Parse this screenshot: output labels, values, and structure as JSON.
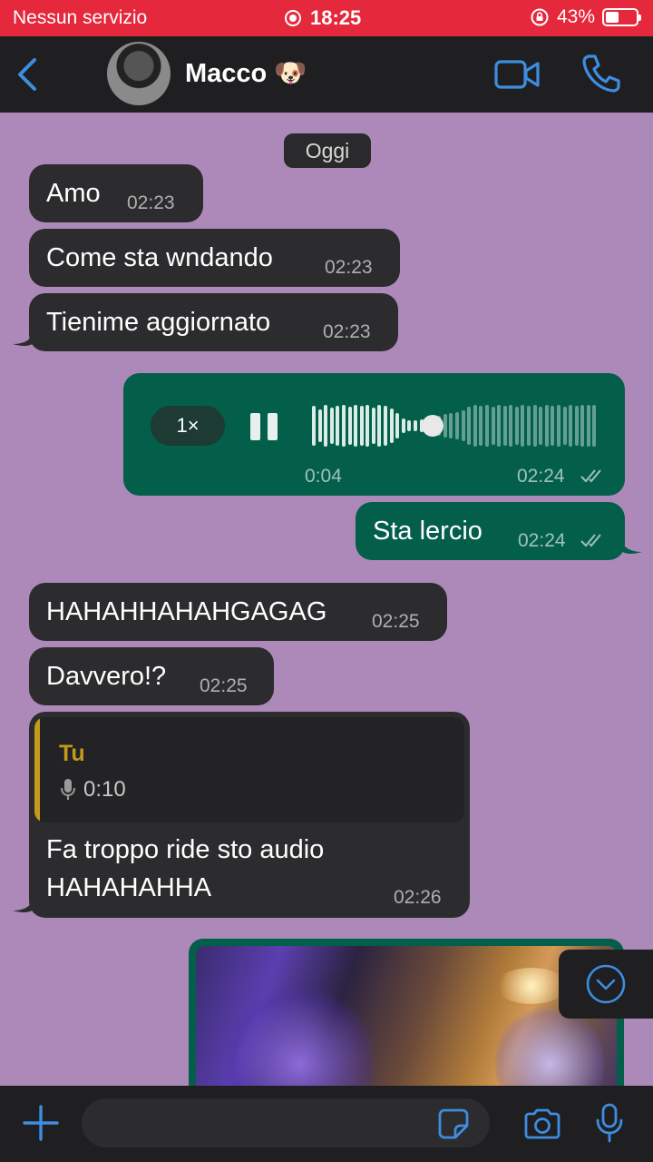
{
  "status_bar": {
    "carrier": "Nessun servizio",
    "time": "18:25",
    "battery": "43%",
    "battery_level": 0.43
  },
  "header": {
    "contact_name": "Macco 🐶"
  },
  "chat": {
    "date_separator": "Oggi",
    "messages": [
      {
        "text": "Amo",
        "time": "02:23"
      },
      {
        "text": "Come sta wndando",
        "time": "02:23"
      },
      {
        "text": "Tienime aggiornato",
        "time": "02:23"
      },
      {
        "type": "voice",
        "speed": "1×",
        "elapsed": "0:04",
        "time": "02:24",
        "progress": 0.42
      },
      {
        "text": "Sta lercio",
        "time": "02:24"
      },
      {
        "text": "HAHAHHAHAHGAGAG",
        "time": "02:25"
      },
      {
        "text": "Davvero!?",
        "time": "02:25"
      },
      {
        "reply_author": "Tu",
        "reply_duration": "0:10",
        "line1": "Fa troppo ride sto audio",
        "line2": "HAHAHAHHA",
        "time": "02:26"
      }
    ]
  },
  "composer": {
    "placeholder": ""
  },
  "colors": {
    "background": "#ad89ba",
    "incoming_bubble": "#2c2c2e",
    "outgoing_bubble": "#035e4a",
    "accent": "#3d8de0",
    "status_bar": "#e5283b",
    "quote_author": "#c39a1b"
  }
}
